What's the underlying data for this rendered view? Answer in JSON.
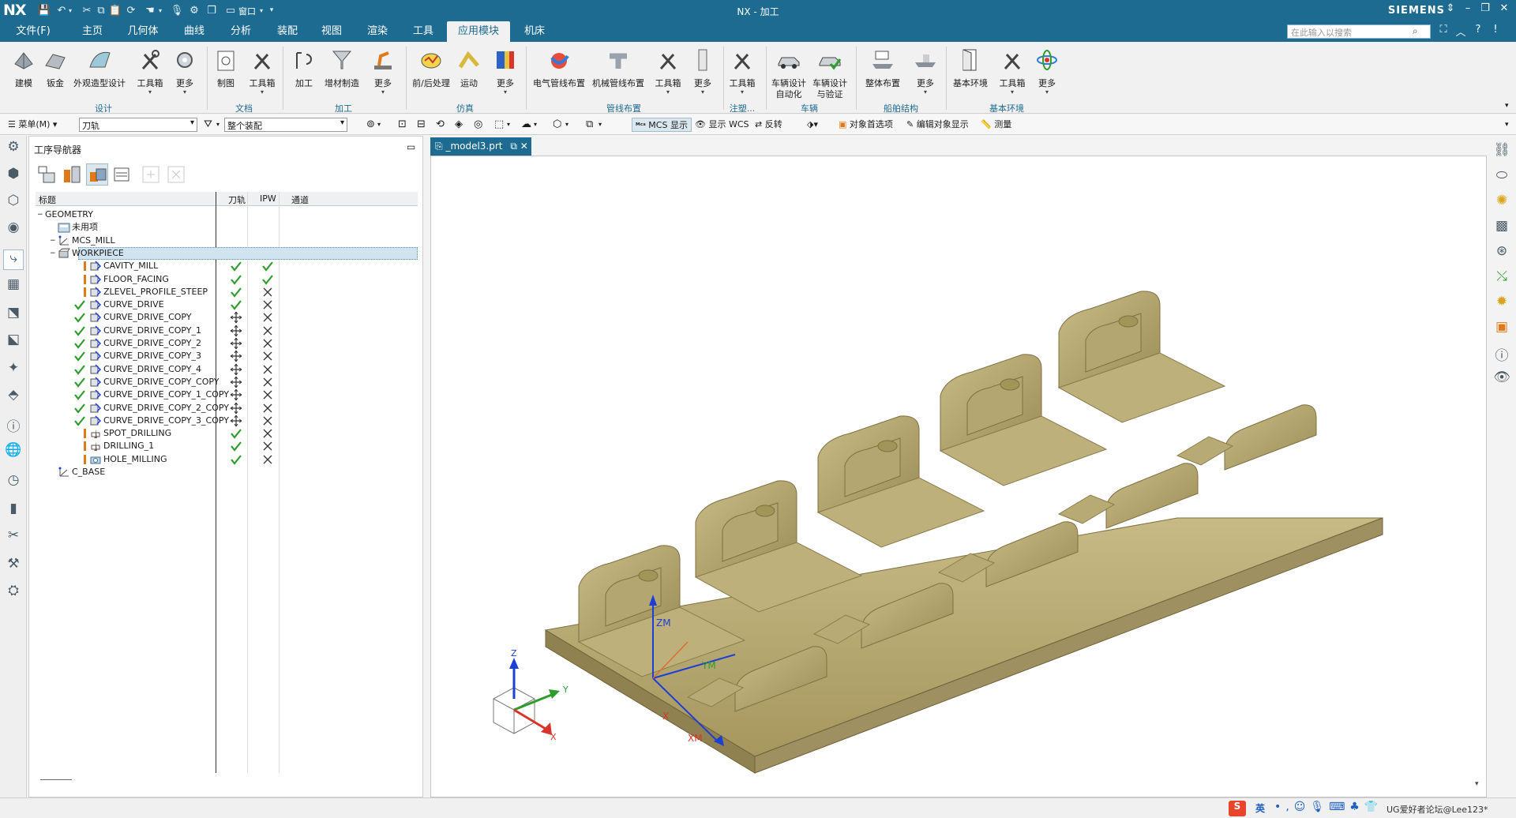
{
  "window": {
    "app_logo": "NX",
    "title": "NX - 加工",
    "brand": "SIEMENS",
    "window_menu_label": "窗口"
  },
  "menubar": {
    "tabs": [
      "文件(F)",
      "主页",
      "几何体",
      "曲线",
      "分析",
      "装配",
      "视图",
      "渲染",
      "工具",
      "应用模块",
      "机床"
    ],
    "active_tab": "应用模块",
    "search_placeholder": "在此输入以搜索"
  },
  "ribbon": {
    "groups": [
      {
        "label": "设计",
        "buttons": [
          "建模",
          "钣金",
          "外观造型设计",
          "工具箱",
          "更多"
        ]
      },
      {
        "label": "文档",
        "buttons": [
          "制图",
          "工具箱"
        ]
      },
      {
        "label": "加工",
        "buttons": [
          "加工",
          "增材制造",
          "更多"
        ]
      },
      {
        "label": "仿真",
        "buttons": [
          "前/后处理",
          "运动",
          "更多"
        ]
      },
      {
        "label": "管线布置",
        "buttons": [
          "电气管线布置",
          "机械管线布置",
          "工具箱",
          "更多"
        ]
      },
      {
        "label": "注塑...",
        "buttons": [
          "工具箱"
        ]
      },
      {
        "label": "车辆",
        "buttons": [
          "车辆设计\n自动化",
          "车辆设计\n与验证"
        ]
      },
      {
        "label": "船舶结构",
        "buttons": [
          "整体布置",
          "更多"
        ]
      },
      {
        "label": "基本环境",
        "buttons": [
          "基本环境",
          "工具箱",
          "更多"
        ]
      }
    ]
  },
  "toolbar2": {
    "menu_label": "菜单(M)",
    "filter_combo": "刀轨",
    "assembly_combo": "整个装配",
    "mcs_display": "MCS 显示",
    "wcs_display": "显示 WCS",
    "reverse": "反转",
    "object_prefs": "对象首选项",
    "edit_object_display": "编辑对象显示",
    "measure": "测量"
  },
  "navigator": {
    "title": "工序导航器",
    "columns": [
      "标题",
      "刀轨",
      "IPW",
      "通道"
    ],
    "rows": [
      {
        "name": "GEOMETRY",
        "indent": 0,
        "toolpath": "",
        "ipw": "",
        "status": "",
        "icon": "folder"
      },
      {
        "name": "未用项",
        "indent": 1,
        "toolpath": "",
        "ipw": "",
        "status": "",
        "icon": "folder"
      },
      {
        "name": "MCS_MILL",
        "indent": 1,
        "toolpath": "",
        "ipw": "",
        "status": "",
        "icon": "mcs"
      },
      {
        "name": "WORKPIECE",
        "indent": 2,
        "toolpath": "",
        "ipw": "",
        "status": "",
        "icon": "workpiece",
        "selected": true
      },
      {
        "name": "CAVITY_MILL",
        "indent": 3,
        "toolpath": "ok",
        "ipw": "ok",
        "status": "bang",
        "icon": "op"
      },
      {
        "name": "FLOOR_FACING",
        "indent": 3,
        "toolpath": "ok",
        "ipw": "ok",
        "status": "bang",
        "icon": "op"
      },
      {
        "name": "ZLEVEL_PROFILE_STEEP",
        "indent": 3,
        "toolpath": "ok",
        "ipw": "x",
        "status": "bang",
        "icon": "op"
      },
      {
        "name": "CURVE_DRIVE",
        "indent": 3,
        "toolpath": "ok",
        "ipw": "x",
        "status": "ok",
        "icon": "op"
      },
      {
        "name": "CURVE_DRIVE_COPY",
        "indent": 3,
        "toolpath": "move",
        "ipw": "x",
        "status": "ok",
        "icon": "op"
      },
      {
        "name": "CURVE_DRIVE_COPY_1",
        "indent": 3,
        "toolpath": "move",
        "ipw": "x",
        "status": "ok",
        "icon": "op"
      },
      {
        "name": "CURVE_DRIVE_COPY_2",
        "indent": 3,
        "toolpath": "move",
        "ipw": "x",
        "status": "ok",
        "icon": "op"
      },
      {
        "name": "CURVE_DRIVE_COPY_3",
        "indent": 3,
        "toolpath": "move",
        "ipw": "x",
        "status": "ok",
        "icon": "op"
      },
      {
        "name": "CURVE_DRIVE_COPY_4",
        "indent": 3,
        "toolpath": "move",
        "ipw": "x",
        "status": "ok",
        "icon": "op"
      },
      {
        "name": "CURVE_DRIVE_COPY_COPY",
        "indent": 3,
        "toolpath": "move",
        "ipw": "x",
        "status": "ok",
        "icon": "op"
      },
      {
        "name": "CURVE_DRIVE_COPY_1_COPY",
        "indent": 3,
        "toolpath": "move",
        "ipw": "x",
        "status": "ok",
        "icon": "op"
      },
      {
        "name": "CURVE_DRIVE_COPY_2_COPY",
        "indent": 3,
        "toolpath": "move",
        "ipw": "x",
        "status": "ok",
        "icon": "op"
      },
      {
        "name": "CURVE_DRIVE_COPY_3_COPY",
        "indent": 3,
        "toolpath": "move",
        "ipw": "x",
        "status": "ok",
        "icon": "op"
      },
      {
        "name": "SPOT_DRILLING",
        "indent": 3,
        "toolpath": "ok",
        "ipw": "x",
        "status": "bang",
        "icon": "drill"
      },
      {
        "name": "DRILLING_1",
        "indent": 3,
        "toolpath": "ok",
        "ipw": "x",
        "status": "bang",
        "icon": "drill"
      },
      {
        "name": "HOLE_MILLING",
        "indent": 3,
        "toolpath": "ok",
        "ipw": "x",
        "status": "bang",
        "icon": "hole"
      },
      {
        "name": "C_BASE",
        "indent": 1,
        "toolpath": "",
        "ipw": "",
        "status": "",
        "icon": "mcs"
      }
    ]
  },
  "graphics": {
    "tab_label": "_model3.prt",
    "triad_labels": {
      "z": "Z",
      "y": "Y",
      "x": "X",
      "zm": "ZM",
      "ym": "YM",
      "xm": "XM"
    }
  },
  "statusbar": {
    "ime_label": "英",
    "watermark": "UG爱好者论坛@Lee123*"
  },
  "colors": {
    "accent": "#1d6b91",
    "part": "#b3a56f",
    "check": "#2e9d2e"
  }
}
